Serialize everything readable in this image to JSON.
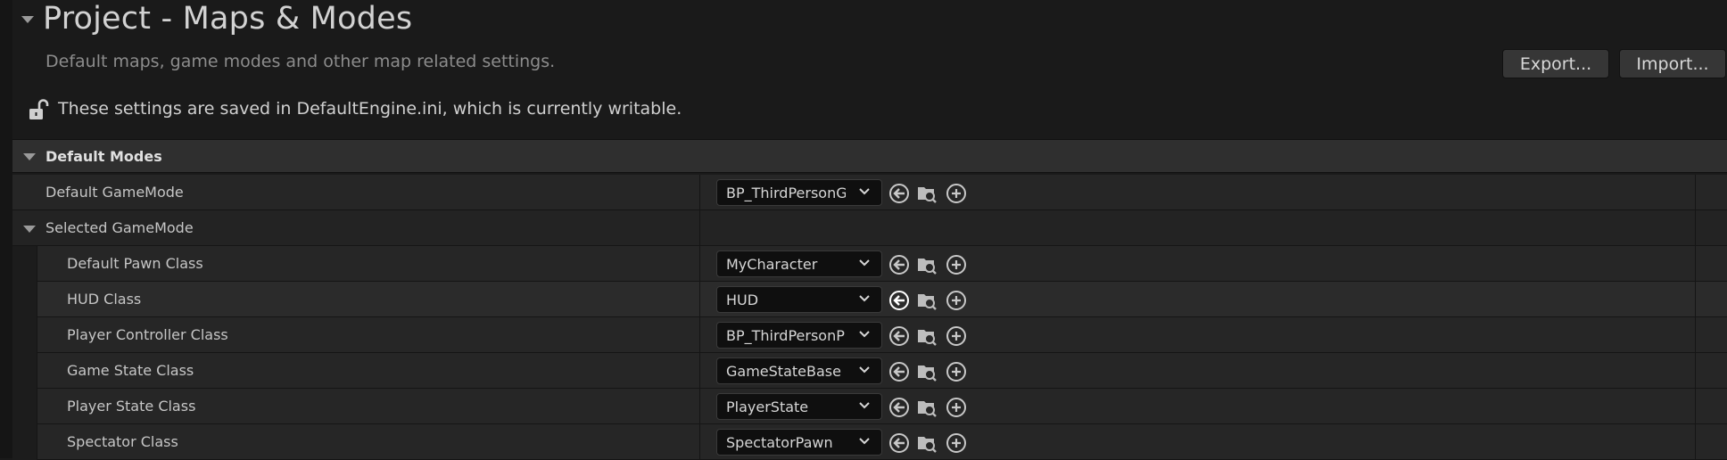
{
  "header": {
    "title": "Project - Maps & Modes",
    "subtitle": "Default maps, game modes and other map related settings.",
    "export_label": "Export...",
    "import_label": "Import...",
    "notice": "These settings are saved in DefaultEngine.ini, which is currently writable."
  },
  "section": {
    "title": "Default Modes"
  },
  "rows": [
    {
      "label": "Default GameMode",
      "value": "BP_ThirdPersonGa"
    },
    {
      "label": "Selected GameMode"
    },
    {
      "label": "Default Pawn Class",
      "value": "MyCharacter"
    },
    {
      "label": "HUD Class",
      "value": "HUD"
    },
    {
      "label": "Player Controller Class",
      "value": "BP_ThirdPersonPla"
    },
    {
      "label": "Game State Class",
      "value": "GameStateBase"
    },
    {
      "label": "Player State Class",
      "value": "PlayerState"
    },
    {
      "label": "Spectator Class",
      "value": "SpectatorPawn"
    }
  ],
  "colors": {
    "background": "#1a1a1a",
    "section_header": "#2f2f2f",
    "row": "#262626",
    "combo": "#0f0f0f",
    "text": "#c6c6c6"
  },
  "icons": [
    "collapse-arrow-icon",
    "lock-open-icon",
    "chevron-down-icon",
    "use-selected-icon",
    "browse-icon",
    "add-icon"
  ]
}
